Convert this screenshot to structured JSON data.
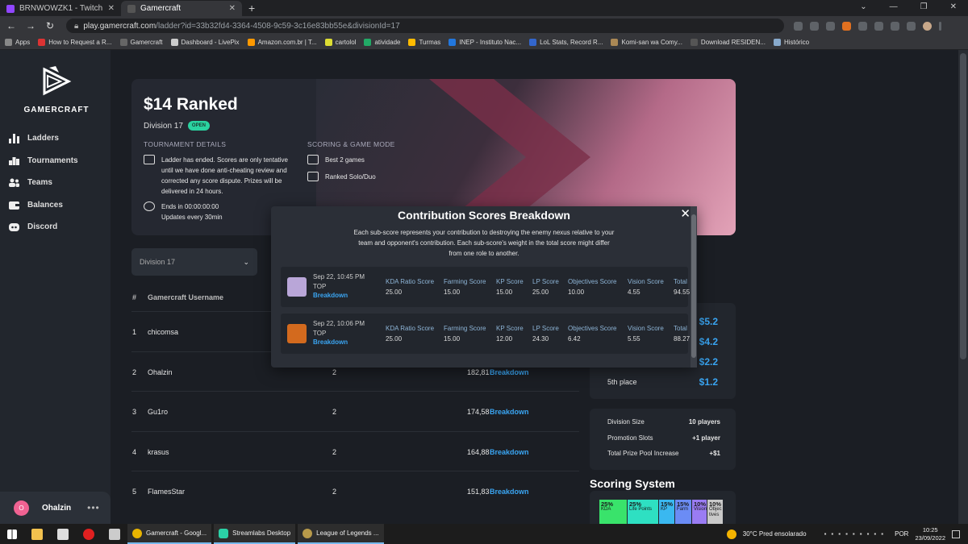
{
  "browser": {
    "tabs": [
      {
        "title": "BRNWOWZK1 - Twitch",
        "color": "#9146ff"
      },
      {
        "title": "Gamercraft",
        "color": "#3b3f47"
      }
    ],
    "url_host": "play.gamercraft.com",
    "url_path": "/ladder?id=33b32fd4-3364-4508-9c59-3c16e83bb55e&divisionId=17",
    "bookmarks": [
      {
        "label": "Apps",
        "color": "#888"
      },
      {
        "label": "How to Request a R...",
        "color": "#d33"
      },
      {
        "label": "Gamercraft",
        "color": "#666"
      },
      {
        "label": "Dashboard - LivePix",
        "color": "#ccc"
      },
      {
        "label": "Amazon.com.br | T...",
        "color": "#f90"
      },
      {
        "label": "cartolol",
        "color": "#dd3"
      },
      {
        "label": "atividade",
        "color": "#2a6"
      },
      {
        "label": "Turmas",
        "color": "#fb0"
      },
      {
        "label": "INEP - Instituto Nac...",
        "color": "#27d"
      },
      {
        "label": "LoL Stats, Record R...",
        "color": "#36c"
      },
      {
        "label": "Komi-san wa Comy...",
        "color": "#a85"
      },
      {
        "label": "Download RESIDEN...",
        "color": "#555"
      },
      {
        "label": "Histórico",
        "color": "#8ac"
      }
    ]
  },
  "sidebar": {
    "brand": "GAMERCRAFT",
    "items": [
      {
        "label": "Ladders",
        "icon": "bar-chart-icon"
      },
      {
        "label": "Tournaments",
        "icon": "trophy-icon"
      },
      {
        "label": "Teams",
        "icon": "users-icon"
      },
      {
        "label": "Balances",
        "icon": "wallet-icon"
      },
      {
        "label": "Discord",
        "icon": "discord-icon"
      }
    ],
    "user": {
      "initial": "O",
      "name": "Ohalzin",
      "menu": "•••"
    }
  },
  "hero": {
    "title": "$14 Ranked",
    "division": "Division 17",
    "status": "OPEN",
    "details_heading": "TOURNAMENT DETAILS",
    "detail_text": "Ladder has ended. Scores are only tentative until we have done anti-cheating review and corrected any score dispute. Prizes will be delivered in 24 hours.",
    "ends_text": "Ends in 00:00:00:00",
    "updates_text": "Updates every 30min",
    "scoring_heading": "SCORING & GAME MODE",
    "best_games": "Best 2 games",
    "mode": "Ranked Solo/Duo"
  },
  "division_select": "Division 17",
  "table": {
    "col_rank": "#",
    "col_user": "Gamercraft Username",
    "rows": [
      {
        "rank": "1",
        "name": "chicomsa",
        "games": "",
        "score": "",
        "breakdown": ""
      },
      {
        "rank": "2",
        "name": "Ohalzin",
        "games": "2",
        "score": "182,81",
        "breakdown": "Breakdown"
      },
      {
        "rank": "3",
        "name": "Gu1ro",
        "games": "2",
        "score": "174,58",
        "breakdown": "Breakdown"
      },
      {
        "rank": "4",
        "name": "krasus",
        "games": "2",
        "score": "164,88",
        "breakdown": "Breakdown"
      },
      {
        "rank": "5",
        "name": "FlamesStar",
        "games": "2",
        "score": "151,83",
        "breakdown": "Breakdown"
      }
    ]
  },
  "prizes": [
    {
      "label": "",
      "value": "$5.2"
    },
    {
      "label": "",
      "value": "$4.2"
    },
    {
      "label": "",
      "value": "$2.2"
    },
    {
      "label": "5th place",
      "value": "$1.2"
    }
  ],
  "division_info": [
    {
      "label": "Division Size",
      "value": "10 players"
    },
    {
      "label": "Promotion Slots",
      "value": "+1 player"
    },
    {
      "label": "Total Prize Pool Increase",
      "value": "+$1"
    }
  ],
  "scoring_system": {
    "title": "Scoring System",
    "segments": [
      {
        "pct": "25%",
        "label": "KDA",
        "color": "#39e36b"
      },
      {
        "pct": "25%",
        "label": "Life Points",
        "color": "#2ee0c2"
      },
      {
        "pct": "15%",
        "label": "KP",
        "color": "#3ab8f0"
      },
      {
        "pct": "15%",
        "label": "Farm",
        "color": "#6b8cf5"
      },
      {
        "pct": "10%",
        "label": "Vision",
        "color": "#9a7cf3"
      },
      {
        "pct": "10%",
        "label": "Objec tives",
        "color": "#c9c9c9"
      }
    ]
  },
  "modal": {
    "title": "Contribution Scores Breakdown",
    "close": "✕",
    "description": "Each sub-score represents your contribution to destroying the enemy nexus relative to your team and opponent's contribution. Each sub-score's weight in the total score might differ from one role to another.",
    "headers": [
      "KDA Ratio Score",
      "Farming Score",
      "KP Score",
      "LP Score",
      "Objectives Score",
      "Vision Score",
      "Total"
    ],
    "matches": [
      {
        "date": "Sep 22, 10:45 PM",
        "role": "TOP",
        "breakdown": "Breakdown",
        "champ_color": "#b9a6d8",
        "values": [
          "25.00",
          "15.00",
          "15.00",
          "25.00",
          "10.00",
          "4.55",
          "94.55"
        ]
      },
      {
        "date": "Sep 22, 10:06 PM",
        "role": "TOP",
        "breakdown": "Breakdown",
        "champ_color": "#d36a1e",
        "values": [
          "25.00",
          "15.00",
          "12.00",
          "24.30",
          "6.42",
          "5.55",
          "88.27"
        ]
      }
    ]
  },
  "taskbar": {
    "apps": [
      "Gamercraft - Googl...",
      "Streamlabs Desktop",
      "League of Legends ..."
    ],
    "weather": "30°C  Pred ensolarado",
    "lang": "POR",
    "time": "10:25",
    "date": "23/09/2022"
  }
}
